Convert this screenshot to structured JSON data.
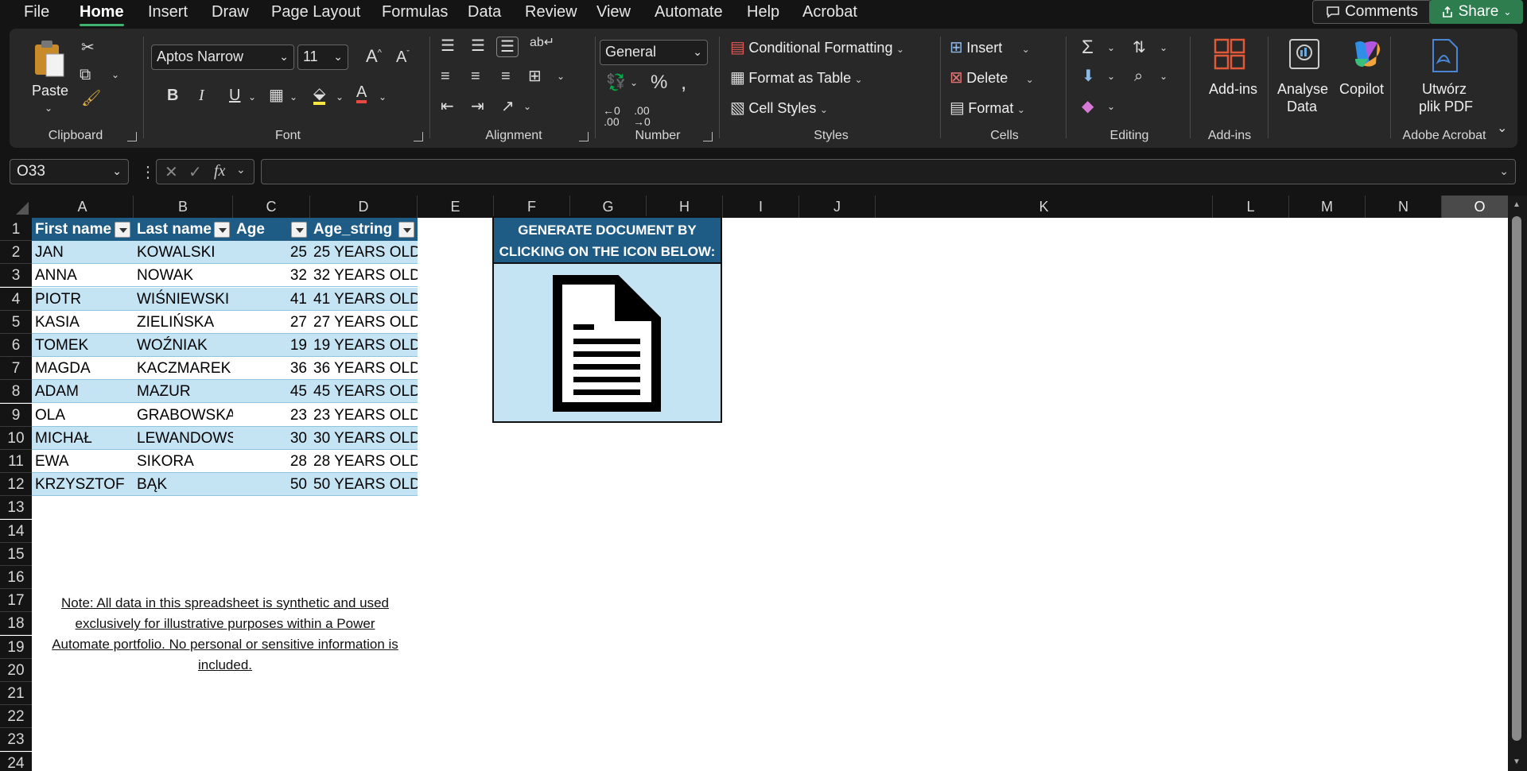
{
  "menu": {
    "tabs": [
      "File",
      "Home",
      "Insert",
      "Draw",
      "Page Layout",
      "Formulas",
      "Data",
      "Review",
      "View",
      "Automate",
      "Help",
      "Acrobat"
    ],
    "active": "Home",
    "comments_label": "Comments",
    "share_label": "Share"
  },
  "ribbon": {
    "clipboard": {
      "paste": "Paste",
      "group": "Clipboard"
    },
    "font": {
      "name": "Aptos Narrow",
      "size": "11",
      "group": "Font",
      "bold": "B",
      "italic": "I",
      "underline": "U"
    },
    "alignment": {
      "group": "Alignment"
    },
    "number": {
      "format": "General",
      "group": "Number"
    },
    "styles": {
      "conditional": "Conditional Formatting",
      "format_table": "Format as Table",
      "cell_styles": "Cell Styles",
      "group": "Styles"
    },
    "cells": {
      "insert": "Insert",
      "delete": "Delete",
      "format": "Format",
      "group": "Cells"
    },
    "editing": {
      "group": "Editing"
    },
    "addins": {
      "label": "Add-ins",
      "group": "Add-ins"
    },
    "analyse": {
      "line1": "Analyse",
      "line2": "Data"
    },
    "copilot": {
      "label": "Copilot"
    },
    "acrobat": {
      "line1": "Utwórz",
      "line2": "plik PDF",
      "group": "Adobe Acrobat"
    }
  },
  "formula_bar": {
    "name_box": "O33",
    "formula": ""
  },
  "columns": [
    "A",
    "B",
    "C",
    "D",
    "E",
    "F",
    "G",
    "H",
    "I",
    "J",
    "K",
    "L",
    "M",
    "N",
    "O"
  ],
  "selected_column": "O",
  "rows": [
    "1",
    "2",
    "3",
    "4",
    "5",
    "6",
    "7",
    "8",
    "9",
    "10",
    "11",
    "12",
    "13",
    "14",
    "15",
    "16",
    "17",
    "18",
    "19",
    "20",
    "21",
    "22",
    "23",
    "24"
  ],
  "table": {
    "headers": [
      "First name",
      "Last name",
      "Age",
      "Age_string"
    ],
    "rows": [
      [
        "JAN",
        "KOWALSKI",
        "25",
        "25 YEARS OLD"
      ],
      [
        "ANNA",
        "NOWAK",
        "32",
        "32 YEARS OLD"
      ],
      [
        "PIOTR",
        "WIŚNIEWSKI",
        "41",
        "41 YEARS OLD"
      ],
      [
        "KASIA",
        "ZIELIŃSKA",
        "27",
        "27 YEARS OLD"
      ],
      [
        "TOMEK",
        "WOŹNIAK",
        "19",
        "19 YEARS OLD"
      ],
      [
        "MAGDA",
        "KACZMAREK",
        "36",
        "36 YEARS OLD"
      ],
      [
        "ADAM",
        "MAZUR",
        "45",
        "45 YEARS OLD"
      ],
      [
        "OLA",
        "GRABOWSKA",
        "23",
        "23 YEARS OLD"
      ],
      [
        "MICHAŁ",
        "LEWANDOWS",
        "30",
        "30 YEARS OLD"
      ],
      [
        "EWA",
        "SIKORA",
        "28",
        "28 YEARS OLD"
      ],
      [
        "KRZYSZTOF",
        "BĄK",
        "50",
        "50 YEARS OLD"
      ]
    ]
  },
  "generate_box": {
    "line1": "GENERATE DOCUMENT BY",
    "line2": "CLICKING ON THE ICON BELOW:",
    "icon": "document-icon"
  },
  "note": {
    "line1": "Note: All data in this spreadsheet is synthetic and used ",
    "line2": "exclusively for illustrative purposes within a Power ",
    "line3": "Automate portfolio. No personal or sensitive information is ",
    "line4": "included. "
  }
}
